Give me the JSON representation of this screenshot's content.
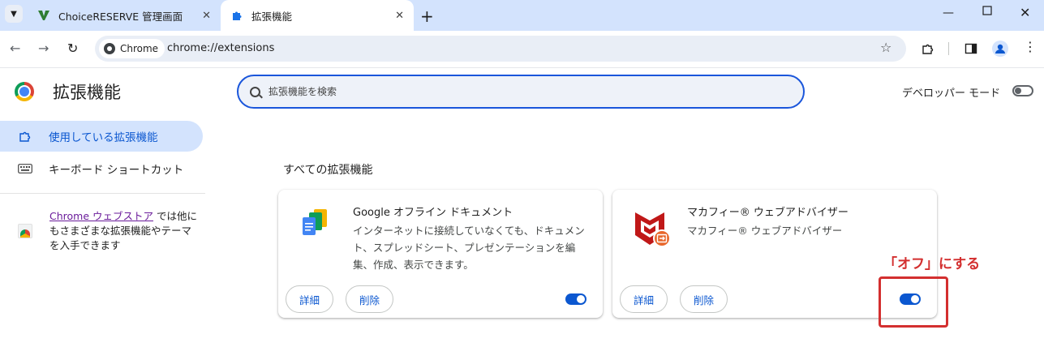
{
  "tabs": [
    {
      "title": "ChoiceRESERVE 管理画面",
      "close": "✕",
      "icon": "v-logo-icon"
    },
    {
      "title": "拡張機能",
      "close": "✕",
      "icon": "puzzle-icon"
    }
  ],
  "toolbar": {
    "chip_label": "Chrome",
    "url": "chrome://extensions"
  },
  "page": {
    "title": "拡張機能",
    "search_placeholder": "拡張機能を検索",
    "dev_mode_label": "デベロッパー モード"
  },
  "sidebar": {
    "items": [
      {
        "label": "使用している拡張機能",
        "icon": "puzzle-icon"
      },
      {
        "label": "キーボード ショートカット",
        "icon": "keyboard-icon"
      }
    ],
    "store_link": "Chrome ウェブストア",
    "store_text": " では他にもさまざまな拡張機能やテーマを入手できます"
  },
  "main": {
    "section_title": "すべての拡張機能",
    "extensions": [
      {
        "name": "Google オフライン ドキュメント",
        "description": "インターネットに接続していなくても、ドキュメント、スプレッドシート、プレゼンテーションを編集、作成、表示できます。",
        "details_label": "詳細",
        "remove_label": "削除",
        "enabled": true
      },
      {
        "name": "マカフィー® ウェブアドバイザー",
        "description": "マカフィー® ウェブアドバイザー",
        "details_label": "詳細",
        "remove_label": "削除",
        "enabled": true
      }
    ]
  },
  "annotation": {
    "label": "「オフ」にする",
    "color": "#d32f2f"
  },
  "colors": {
    "accent": "#0b57d0",
    "tabstrip": "#d3e3fd"
  }
}
